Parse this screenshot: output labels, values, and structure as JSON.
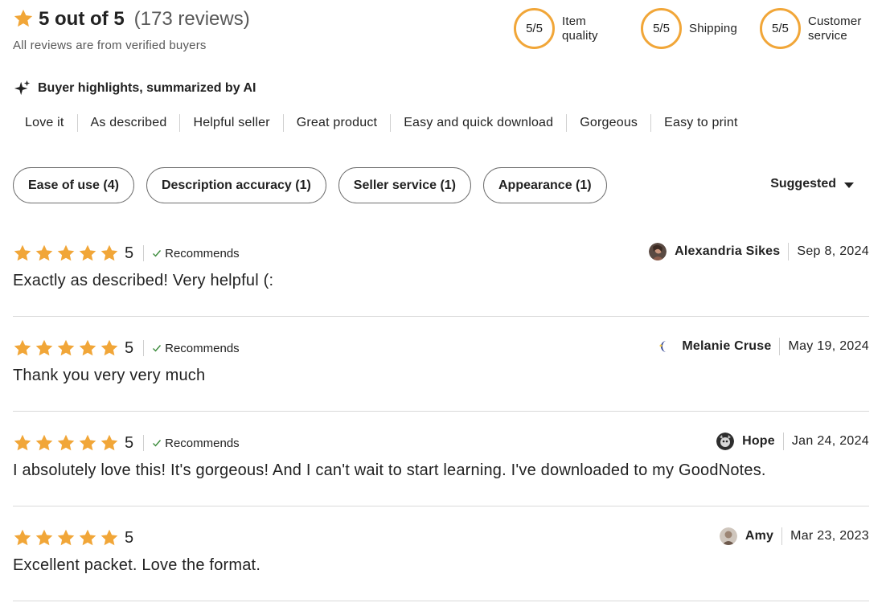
{
  "summary": {
    "rating_text": "5 out of 5",
    "count_text": "(173 reviews)",
    "subtitle": "All reviews are from verified buyers",
    "star_icon": "star-icon",
    "star_color": "#f1a638"
  },
  "scores": [
    {
      "value": "5/5",
      "label": "Item quality"
    },
    {
      "value": "5/5",
      "label": "Shipping"
    },
    {
      "value": "5/5",
      "label": "Customer service"
    }
  ],
  "ai": {
    "title": "Buyer highlights, summarized by AI",
    "icon": "sparkle-icon",
    "highlights": [
      "Love it",
      "As described",
      "Helpful seller",
      "Great product",
      "Easy and quick download",
      "Gorgeous",
      "Easy to print"
    ]
  },
  "filters": [
    "Ease of use (4)",
    "Description accuracy (1)",
    "Seller service (1)",
    "Appearance (1)"
  ],
  "sort": {
    "label": "Suggested",
    "icon": "caret-down-icon"
  },
  "reviews": [
    {
      "rating": 5,
      "rating_text": "5",
      "recommends": "Recommends",
      "text": "Exactly as described! Very helpful (:",
      "reviewer": "Alexandria Sikes",
      "date": "Sep 8, 2024",
      "avatar_icon": "avatar-photo-icon"
    },
    {
      "rating": 5,
      "rating_text": "5",
      "recommends": "Recommends",
      "text": "Thank you very very much",
      "reviewer": "Melanie Cruse",
      "date": "May 19, 2024",
      "avatar_icon": "crescent-moon-icon"
    },
    {
      "rating": 5,
      "rating_text": "5",
      "recommends": "Recommends",
      "text": "I absolutely love this! It's gorgeous! And I can't wait to start learning. I've downloaded to my GoodNotes.",
      "reviewer": "Hope",
      "date": "Jan 24, 2024",
      "avatar_icon": "avatar-photo-icon"
    },
    {
      "rating": 5,
      "rating_text": "5",
      "recommends": "",
      "text": "Excellent packet. Love the format.",
      "reviewer": "Amy",
      "date": "Mar 23, 2023",
      "avatar_icon": "avatar-photo-icon"
    }
  ]
}
